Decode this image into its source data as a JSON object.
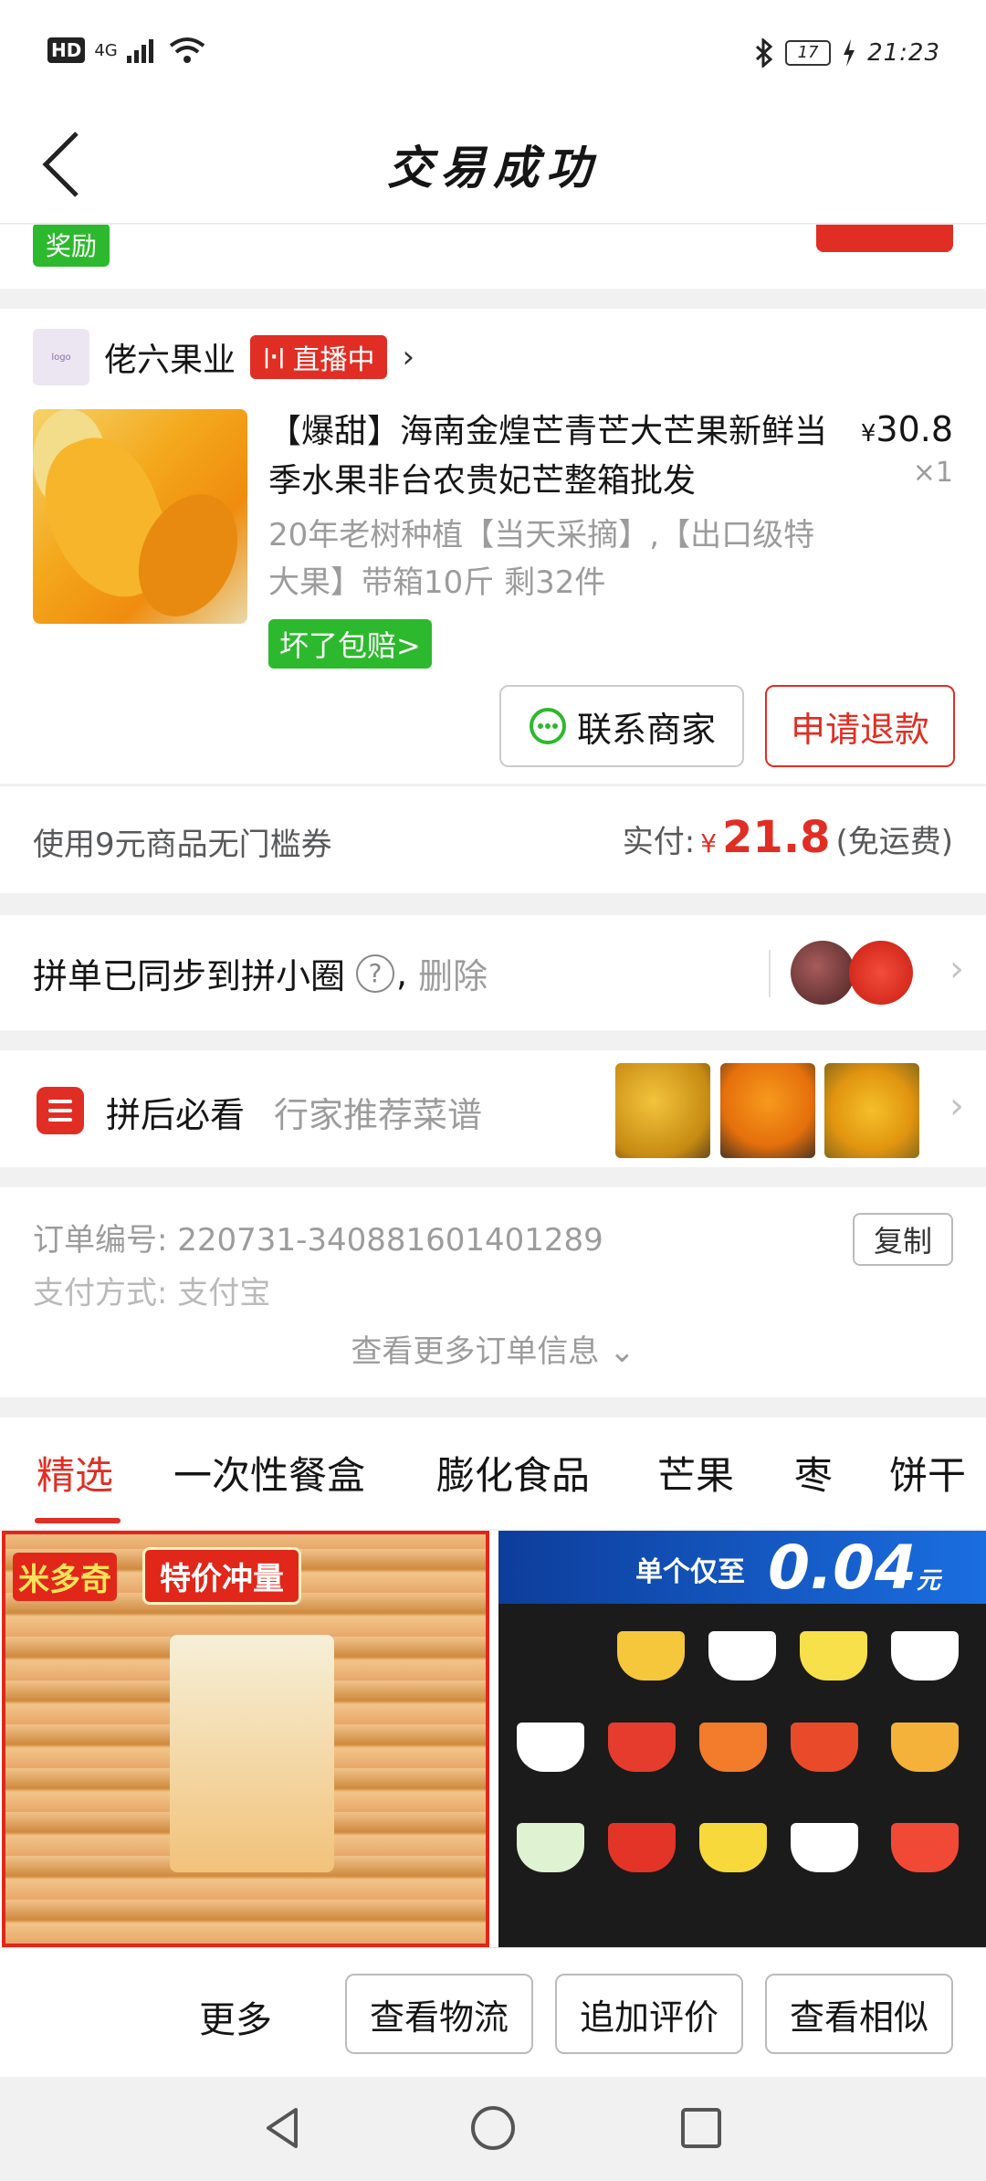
{
  "status_bar": {
    "hd": "HD",
    "network": "4G",
    "battery": "17",
    "time": "21:23"
  },
  "header": {
    "title": "交易成功"
  },
  "partial": {
    "reward_tag": "奖励"
  },
  "order": {
    "store_name": "佬六果业",
    "live_badge": "直播中",
    "product_title": "【爆甜】海南金煌芒青芒大芒果新鲜当季水果非台农贵妃芒整箱批发",
    "price_symbol": "¥",
    "price": "30.8",
    "quantity": "×1",
    "spec": "20年老树种植【当天采摘】,【出口级特大果】带箱10斤 剩32件",
    "guarantee": "坏了包赔>",
    "contact_button": "联系商家",
    "refund_button": "申请退款"
  },
  "payment": {
    "coupon": "使用9元商品无门槛券",
    "paid_label": "实付:",
    "currency": "¥",
    "amount": "21.8",
    "shipping": "(免运费)"
  },
  "sync": {
    "text": "拼单已同步到拼小圈",
    "help": "?",
    "comma": ",",
    "delete": "删除"
  },
  "recipe": {
    "title": "拼后必看",
    "subtitle": "行家推荐菜谱"
  },
  "order_info": {
    "order_no_label": "订单编号:",
    "order_no": "220731-340881601401289",
    "copy_button": "复制",
    "pay_method_label": "支付方式:",
    "pay_method": "支付宝",
    "more": "查看更多订单信息"
  },
  "tabs": [
    "精选",
    "一次性餐盒",
    "膨化食品",
    "芒果",
    "枣",
    "饼干"
  ],
  "feed": {
    "item1_brand": "米多奇",
    "item1_tag": "特价冲量",
    "item2_banner": "单个仅至",
    "item2_price": "0.04",
    "item2_unit": "元"
  },
  "actions": {
    "more": "更多",
    "logistics": "查看物流",
    "add_review": "追加评价",
    "similar": "查看相似"
  },
  "colors": {
    "brand_red": "#e02e24",
    "green": "#2db92d"
  }
}
